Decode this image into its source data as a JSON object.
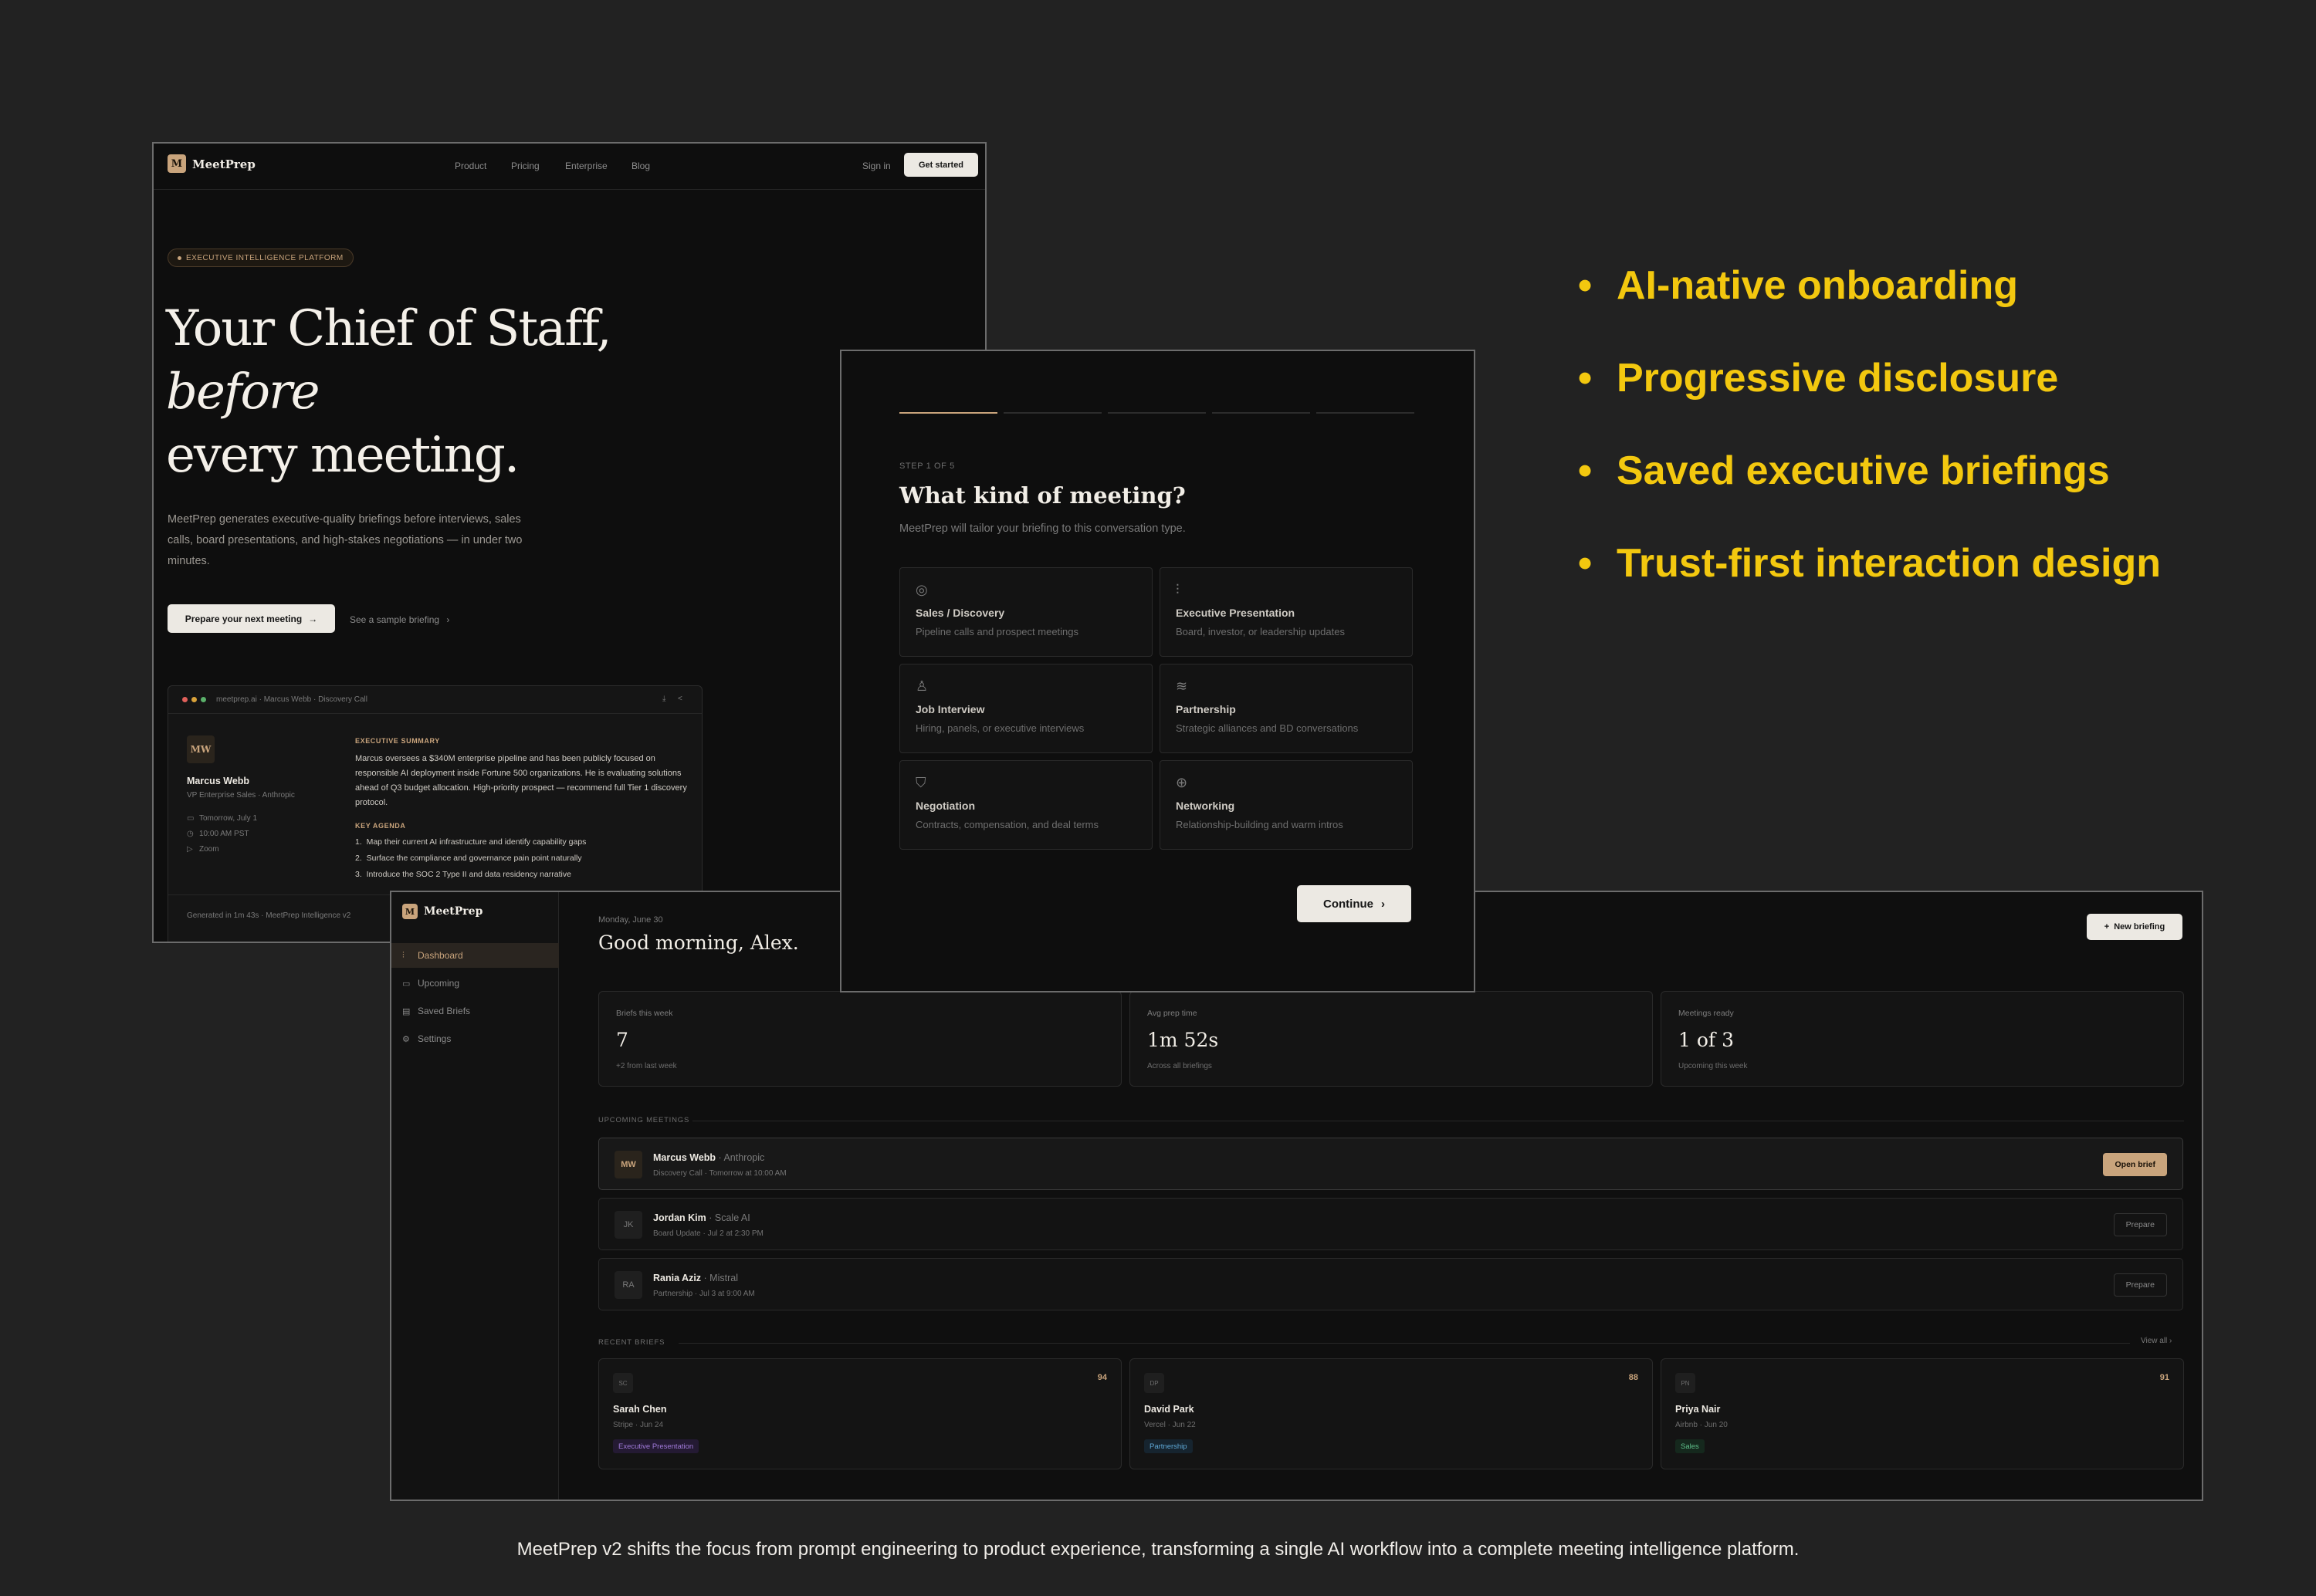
{
  "landing": {
    "brand": {
      "logo_letter": "M",
      "name": "MeetPrep"
    },
    "nav": [
      "Product",
      "Pricing",
      "Enterprise",
      "Blog"
    ],
    "sign_in": "Sign in",
    "get_started": "Get started",
    "pill": "EXECUTIVE INTELLIGENCE PLATFORM",
    "hero": {
      "line1": "Your Chief of Staff,",
      "line2": "before",
      "line3": "every meeting."
    },
    "subtitle": "MeetPrep generates executive-quality briefings before interviews, sales calls, board presentations, and high-stakes negotiations — in under two minutes.",
    "cta": "Prepare your next meeting",
    "sample_link": "See a sample briefing",
    "preview": {
      "url": "meetprep.ai · Marcus Webb · Discovery Call",
      "initials": "MW",
      "name": "Marcus Webb",
      "role": "VP Enterprise Sales · Anthropic",
      "date": "Tomorrow, July 1",
      "time": "10:00 AM PST",
      "channel": "Zoom",
      "summary_label": "EXECUTIVE SUMMARY",
      "summary": "Marcus oversees a $340M enterprise pipeline and has been publicly focused on responsible AI deployment inside Fortune 500 organizations. He is evaluating solutions ahead of Q3 budget allocation. High-priority prospect — recommend full Tier 1 discovery protocol.",
      "agenda_label": "KEY AGENDA",
      "agenda": [
        "Map their current AI infrastructure and identify capability gaps",
        "Surface the compliance and governance pain point naturally",
        "Introduce the SOC 2 Type II and data residency narrative"
      ],
      "footer": "Generated in 1m 43s · MeetPrep Intelligence v2"
    }
  },
  "modal": {
    "step": "STEP 1 OF 5",
    "progress": {
      "current": 1,
      "total": 5
    },
    "title": "What kind of meeting?",
    "subtitle": "MeetPrep will tailor your briefing to this conversation type.",
    "options": [
      {
        "icon": "target-icon",
        "title": "Sales / Discovery",
        "desc": "Pipeline calls and prospect meetings"
      },
      {
        "icon": "bar-chart-icon",
        "title": "Executive Presentation",
        "desc": "Board, investor, or leadership updates"
      },
      {
        "icon": "user-icon",
        "title": "Job Interview",
        "desc": "Hiring, panels, or executive interviews"
      },
      {
        "icon": "layers-icon",
        "title": "Partnership",
        "desc": "Strategic alliances and BD conversations"
      },
      {
        "icon": "shield-icon",
        "title": "Negotiation",
        "desc": "Contracts, compensation, and deal terms"
      },
      {
        "icon": "globe-icon",
        "title": "Networking",
        "desc": "Relationship-building and warm intros"
      }
    ],
    "continue": "Continue"
  },
  "dashboard": {
    "brand": {
      "logo_letter": "M",
      "name": "MeetPrep"
    },
    "sidebar": [
      "Dashboard",
      "Upcoming",
      "Saved Briefs",
      "Settings"
    ],
    "date": "Monday, June 30",
    "greeting": "Good morning, Alex.",
    "new_briefing": "New briefing",
    "stats": [
      {
        "label": "Briefs this week",
        "value": "7",
        "sub": "+2 from last week"
      },
      {
        "label": "Avg prep time",
        "value": "1m 52s",
        "sub": "Across all briefings"
      },
      {
        "label": "Meetings ready",
        "value": "1 of 3",
        "sub": "Upcoming this week"
      }
    ],
    "upcoming_label": "UPCOMING MEETINGS",
    "meetings": [
      {
        "initials": "MW",
        "name": "Marcus Webb",
        "company": "Anthropic",
        "detail": "Discovery Call · Tomorrow at 10:00 AM",
        "action": "Open brief"
      },
      {
        "initials": "JK",
        "name": "Jordan Kim",
        "company": "Scale AI",
        "detail": "Board Update · Jul 2 at 2:30 PM",
        "action": "Prepare"
      },
      {
        "initials": "RA",
        "name": "Rania Aziz",
        "company": "Mistral",
        "detail": "Partnership · Jul 3 at 9:00 AM",
        "action": "Prepare"
      }
    ],
    "recent_label": "RECENT BRIEFS",
    "view_all": "View all",
    "briefs": [
      {
        "initials": "SC",
        "score": "94",
        "name": "Sarah Chen",
        "detail": "Stripe · Jun 24",
        "tag": "Executive Presentation",
        "tag_color": "#a07ad8"
      },
      {
        "initials": "DP",
        "score": "88",
        "name": "David Park",
        "detail": "Vercel · Jun 22",
        "tag": "Partnership",
        "tag_color": "#5fa8d6"
      },
      {
        "initials": "PN",
        "score": "91",
        "name": "Priya Nair",
        "detail": "Airbnb · Jun 20",
        "tag": "Sales",
        "tag_color": "#5fc08a"
      }
    ]
  },
  "bullets": [
    "AI-native onboarding",
    "Progressive disclosure",
    "Saved executive briefings",
    "Trust-first interaction design"
  ],
  "caption": "MeetPrep v2 shifts the focus from prompt engineering to product experience, transforming a single AI workflow into a complete meeting intelligence platform.",
  "colors": {
    "accent_gold": "#c9a47c",
    "bullet_yellow": "#f3c80f",
    "background": "#222222"
  }
}
